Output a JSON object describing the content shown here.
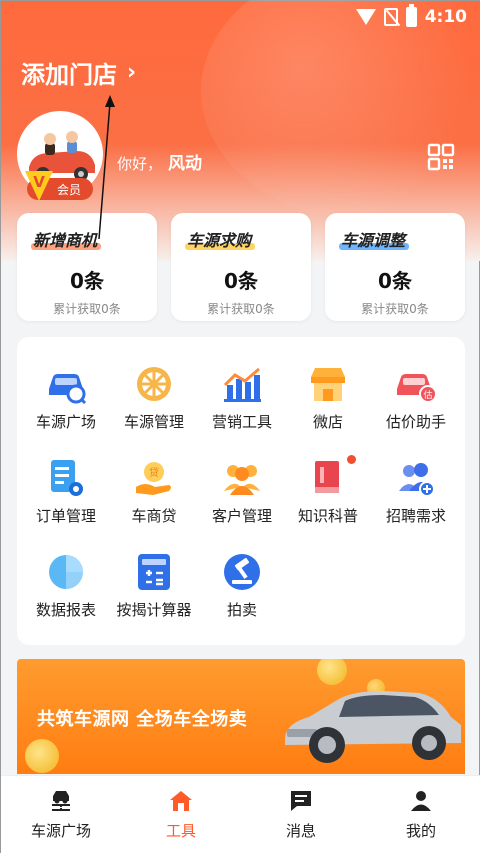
{
  "status_bar": {
    "time": "4:10"
  },
  "header": {
    "store_title": "添加门店",
    "greeting": "你好，",
    "user_name": "风动",
    "vip_label": "会员",
    "vip_letter": "V"
  },
  "stats": [
    {
      "title": "新增商机",
      "count": "0条",
      "sub": "累计获取0条",
      "highlight": "#ff8a5c"
    },
    {
      "title": "车源求购",
      "count": "0条",
      "sub": "累计获取0条",
      "highlight": "#ffc93c"
    },
    {
      "title": "车源调整",
      "count": "0条",
      "sub": "累计获取0条",
      "highlight": "#4aa3ff"
    }
  ],
  "tools": [
    {
      "label": "车源广场",
      "icon": "car-search-icon"
    },
    {
      "label": "车源管理",
      "icon": "wheel-icon"
    },
    {
      "label": "营销工具",
      "icon": "bar-chart-icon"
    },
    {
      "label": "微店",
      "icon": "shop-icon"
    },
    {
      "label": "估价助手",
      "icon": "car-valuation-icon"
    },
    {
      "label": "订单管理",
      "icon": "order-icon"
    },
    {
      "label": "车商贷",
      "icon": "loan-icon"
    },
    {
      "label": "客户管理",
      "icon": "customers-icon"
    },
    {
      "label": "知识科普",
      "icon": "book-icon"
    },
    {
      "label": "招聘需求",
      "icon": "recruit-icon"
    },
    {
      "label": "数据报表",
      "icon": "pie-chart-icon"
    },
    {
      "label": "按揭计算器",
      "icon": "calculator-icon"
    },
    {
      "label": "拍卖",
      "icon": "auction-icon"
    }
  ],
  "banner": {
    "text": "共筑车源网 全场车全场卖"
  },
  "bottom_nav": [
    {
      "label": "车源广场",
      "icon": "car-road-icon",
      "active": false
    },
    {
      "label": "工具",
      "icon": "home-icon",
      "active": true
    },
    {
      "label": "消息",
      "icon": "message-icon",
      "active": false
    },
    {
      "label": "我的",
      "icon": "person-icon",
      "active": false
    }
  ],
  "colors": {
    "accent": "#ff5a2a",
    "header": "#ff6a3d",
    "banner": "#ff8a1f"
  }
}
